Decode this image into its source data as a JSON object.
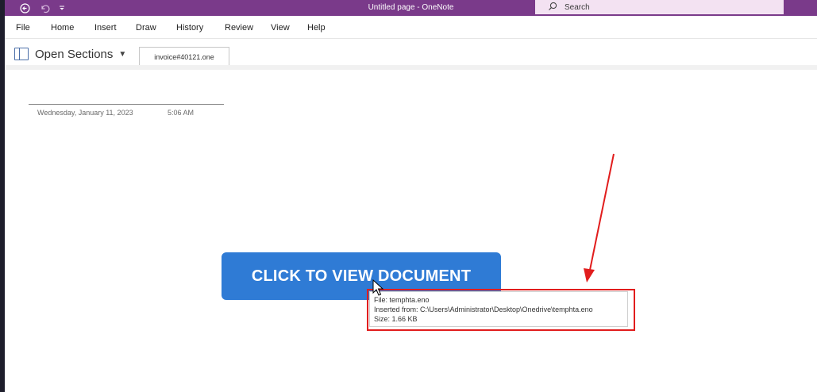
{
  "window": {
    "title": "Untitled page  -  OneNote",
    "search_label": "Search"
  },
  "menu": {
    "items": [
      "File",
      "Home",
      "Insert",
      "Draw",
      "History",
      "Review",
      "View",
      "Help"
    ]
  },
  "sections": {
    "open_sections_label": "Open Sections",
    "tab_label": "invoice#40121.one"
  },
  "page": {
    "date": "Wednesday, January 11, 2023",
    "time": "5:06 AM",
    "button_label": "CLICK TO VIEW DOCUMENT"
  },
  "tooltip": {
    "file": "File: temphta.eno",
    "inserted_from": "Inserted from: C:\\Users\\Administrator\\Desktop\\Onedrive\\temphta.eno",
    "size": "Size: 1.66 KB"
  },
  "colors": {
    "titlebar": "#7a3a8a",
    "button": "#2f7bd5",
    "annotation": "#e11d1d"
  }
}
